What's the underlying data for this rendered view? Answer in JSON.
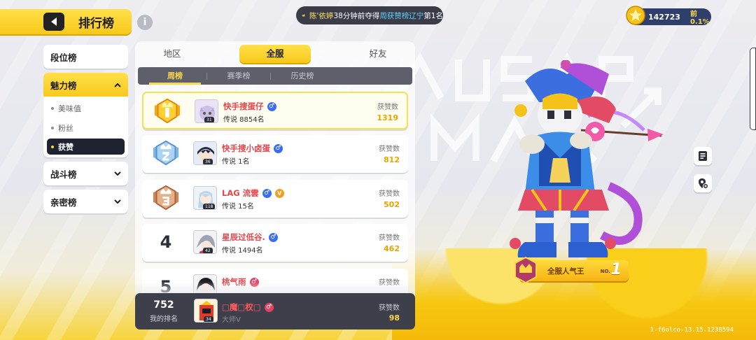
{
  "header": {
    "title": "排行榜",
    "notice": {
      "name": "陈'依婷",
      "time_text": "38分钟前夺得",
      "board": "周获赞榜辽宁",
      "rank_text": "第1名"
    },
    "coins": {
      "value": "142723",
      "percent": "前0.1%"
    }
  },
  "menu": {
    "items": [
      {
        "label": "段位榜"
      },
      {
        "label": "魅力榜",
        "expanded": true,
        "sub": [
          {
            "label": "美味值"
          },
          {
            "label": "粉丝"
          },
          {
            "label": "获赞",
            "active": true
          }
        ]
      },
      {
        "label": "战斗榜"
      },
      {
        "label": "亲密榜"
      }
    ]
  },
  "tabs": [
    {
      "label": "地区"
    },
    {
      "label": "全服",
      "active": true
    },
    {
      "label": "好友"
    }
  ],
  "subtabs": [
    {
      "label": "周榜",
      "active": true
    },
    {
      "label": "赛季榜"
    },
    {
      "label": "历史榜"
    }
  ],
  "likes_label": "获赞数",
  "rows": [
    {
      "rank": "1",
      "name": "快手搜蛋仔",
      "gender": "♂",
      "tier": "传说 8854名",
      "likes": "1319",
      "level": "31"
    },
    {
      "rank": "2",
      "name": "快手搜小卤蛋",
      "gender": "♂",
      "tier": "传说 1名",
      "likes": "812",
      "level": "36"
    },
    {
      "rank": "3",
      "name": "LAG 流雲",
      "gender": "♂",
      "vip": "V",
      "tier": "传说 15名",
      "likes": "502",
      "level": "118"
    },
    {
      "rank": "4",
      "name": "星辰过低谷.",
      "gender": "♂",
      "tier": "传说 1494名",
      "likes": "462",
      "level": "42"
    },
    {
      "rank": "5",
      "name": "桃气雨",
      "gender": "♂",
      "tier": "",
      "likes": "",
      "level": ""
    }
  ],
  "my_rank": {
    "rank": "752",
    "label": "我的排名",
    "name": "□魔□权□",
    "gender": "♂",
    "tier": "大师V",
    "likes": "98",
    "level": "34"
  },
  "title_plate": {
    "text": "全服人气王",
    "no": "NO.",
    "num": "1"
  },
  "version": "1-f6olco-13.15.1238594",
  "colors": {
    "accent": "#f8c81a",
    "panel_dark": "#3d3f4b",
    "name_red": "#e8454a",
    "likes_gold": "#e7a500"
  }
}
